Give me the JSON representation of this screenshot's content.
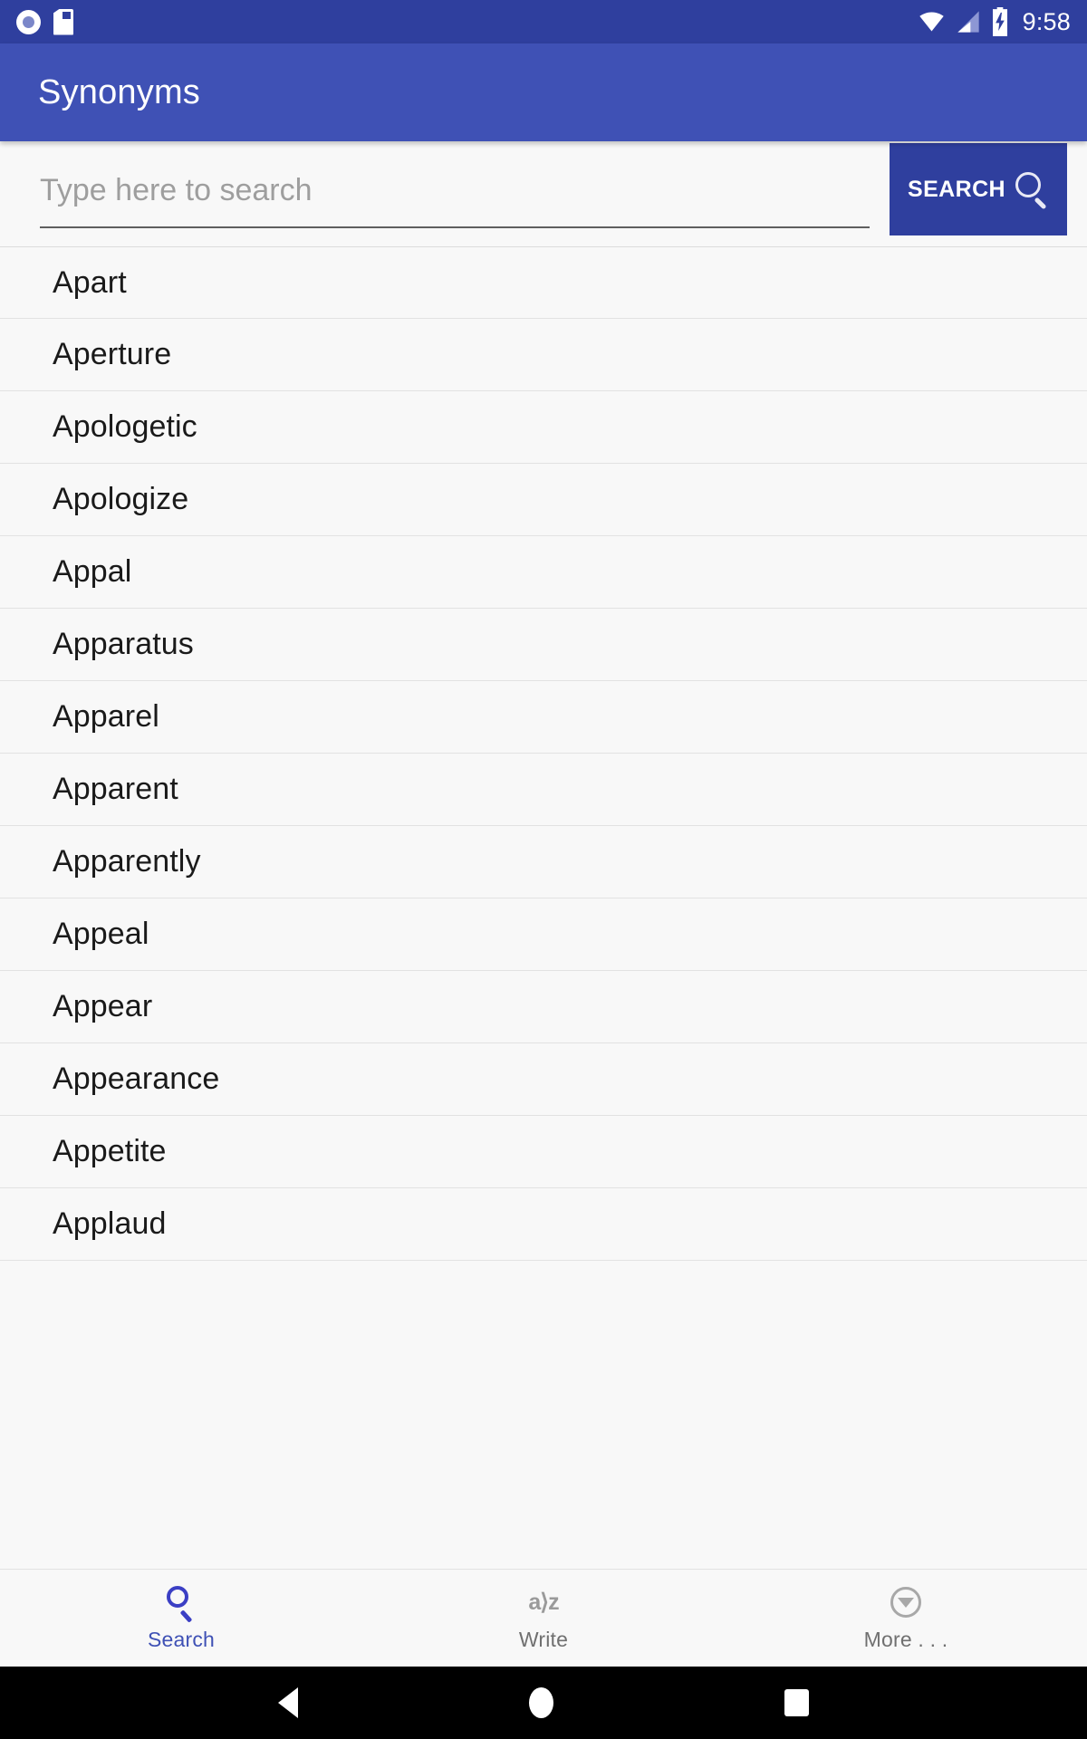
{
  "status_bar": {
    "time": "9:58",
    "left_icons": [
      "screen-record-icon",
      "sd-card-icon"
    ],
    "right_icons": [
      "wifi-icon",
      "cellular-signal-icon",
      "battery-charging-icon"
    ],
    "background_color": "#2f3f9e"
  },
  "app_bar": {
    "title": "Synonyms",
    "background_color": "#3f51b5",
    "text_color": "#ffffff"
  },
  "search": {
    "placeholder": "Type here to search",
    "value": "",
    "button_label": "SEARCH",
    "button_color": "#2f3f9e",
    "button_icon": "magnifier-icon"
  },
  "word_list": {
    "items": [
      {
        "label": "Apart"
      },
      {
        "label": "Aperture"
      },
      {
        "label": "Apologetic"
      },
      {
        "label": "Apologize"
      },
      {
        "label": "Appal"
      },
      {
        "label": "Apparatus"
      },
      {
        "label": "Apparel"
      },
      {
        "label": "Apparent"
      },
      {
        "label": "Apparently"
      },
      {
        "label": "Appeal"
      },
      {
        "label": "Appear"
      },
      {
        "label": "Appearance"
      },
      {
        "label": "Appetite"
      },
      {
        "label": "Applaud"
      }
    ]
  },
  "tab_bar": {
    "active_color": "#3f51b5",
    "inactive_color": "#707070",
    "tabs": [
      {
        "label": "Search",
        "icon": "magnifier-icon",
        "active": true
      },
      {
        "label": "Write",
        "icon": "a-to-z-icon",
        "active": false
      },
      {
        "label": "More . . .",
        "icon": "chevron-down-circle-icon",
        "active": false
      }
    ]
  },
  "system_nav": {
    "buttons": [
      "back-icon",
      "home-icon",
      "recents-icon"
    ]
  }
}
